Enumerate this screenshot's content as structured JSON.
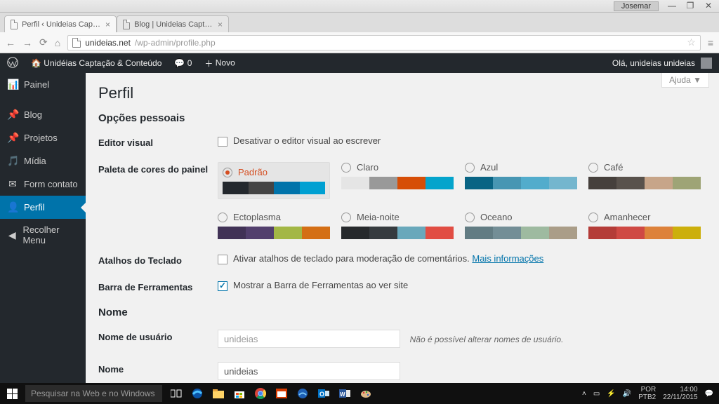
{
  "window": {
    "user_chip": "Josemar"
  },
  "browser": {
    "tabs": [
      {
        "title": "Perfil ‹ Unideias Captação ..."
      },
      {
        "title": "Blog | Unideias Captação ..."
      }
    ],
    "url_host": "unideias.net",
    "url_path": "/wp-admin/profile.php"
  },
  "wp_bar": {
    "site_name": "Unidéias Captação & Conteúdo",
    "comments": "0",
    "new_label": "Novo",
    "greeting": "Olá, unideias unideias"
  },
  "sidebar": {
    "items": [
      {
        "icon": "📊",
        "label": "Painel"
      },
      {
        "icon": "📌",
        "label": "Blog"
      },
      {
        "icon": "📌",
        "label": "Projetos"
      },
      {
        "icon": "🎵",
        "label": "Mídia"
      },
      {
        "icon": "✉",
        "label": "Form contato"
      },
      {
        "icon": "👤",
        "label": "Perfil"
      },
      {
        "icon": "◀",
        "label": "Recolher Menu"
      }
    ]
  },
  "page": {
    "help": "Ajuda",
    "title": "Perfil",
    "section_personal": "Opções pessoais",
    "row_visual": {
      "label": "Editor visual",
      "text": "Desativar o editor visual ao escrever"
    },
    "row_palette_label": "Paleta de cores do painel",
    "schemes": [
      {
        "name": "Padrão",
        "selected": true,
        "colors": [
          "#23282d",
          "#444444",
          "#0073aa",
          "#00a0d2"
        ]
      },
      {
        "name": "Claro",
        "selected": false,
        "colors": [
          "#e5e5e5",
          "#999999",
          "#d64e07",
          "#04a4cc"
        ]
      },
      {
        "name": "Azul",
        "selected": false,
        "colors": [
          "#096484",
          "#4796b3",
          "#52accc",
          "#74b6ce"
        ]
      },
      {
        "name": "Café",
        "selected": false,
        "colors": [
          "#46403c",
          "#59524c",
          "#c7a589",
          "#9ea476"
        ]
      },
      {
        "name": "Ectoplasma",
        "selected": false,
        "colors": [
          "#413256",
          "#523f6d",
          "#a3b745",
          "#d46f15"
        ]
      },
      {
        "name": "Meia-noite",
        "selected": false,
        "colors": [
          "#26292c",
          "#363b3f",
          "#69a8bb",
          "#e14d43"
        ]
      },
      {
        "name": "Oceano",
        "selected": false,
        "colors": [
          "#627c83",
          "#738e96",
          "#9ebaa0",
          "#aa9d88"
        ]
      },
      {
        "name": "Amanhecer",
        "selected": false,
        "colors": [
          "#b43c38",
          "#cf4944",
          "#dd823b",
          "#ccaf0b"
        ]
      }
    ],
    "row_shortcuts": {
      "label": "Atalhos do Teclado",
      "text": "Ativar atalhos de teclado para moderação de comentários. ",
      "link": "Mais informações"
    },
    "row_toolbar": {
      "label": "Barra de Ferramentas",
      "text": "Mostrar a Barra de Ferramentas ao ver site"
    },
    "section_name": "Nome",
    "row_username": {
      "label": "Nome de usuário",
      "value": "unideias",
      "hint": "Não é possível alterar nomes de usuário."
    },
    "row_name": {
      "label": "Nome",
      "value": "unideias"
    }
  },
  "taskbar": {
    "search_placeholder": "Pesquisar na Web e no Windows",
    "lang1": "POR",
    "lang2": "PTB2",
    "time": "14:00",
    "date": "22/11/2015"
  }
}
